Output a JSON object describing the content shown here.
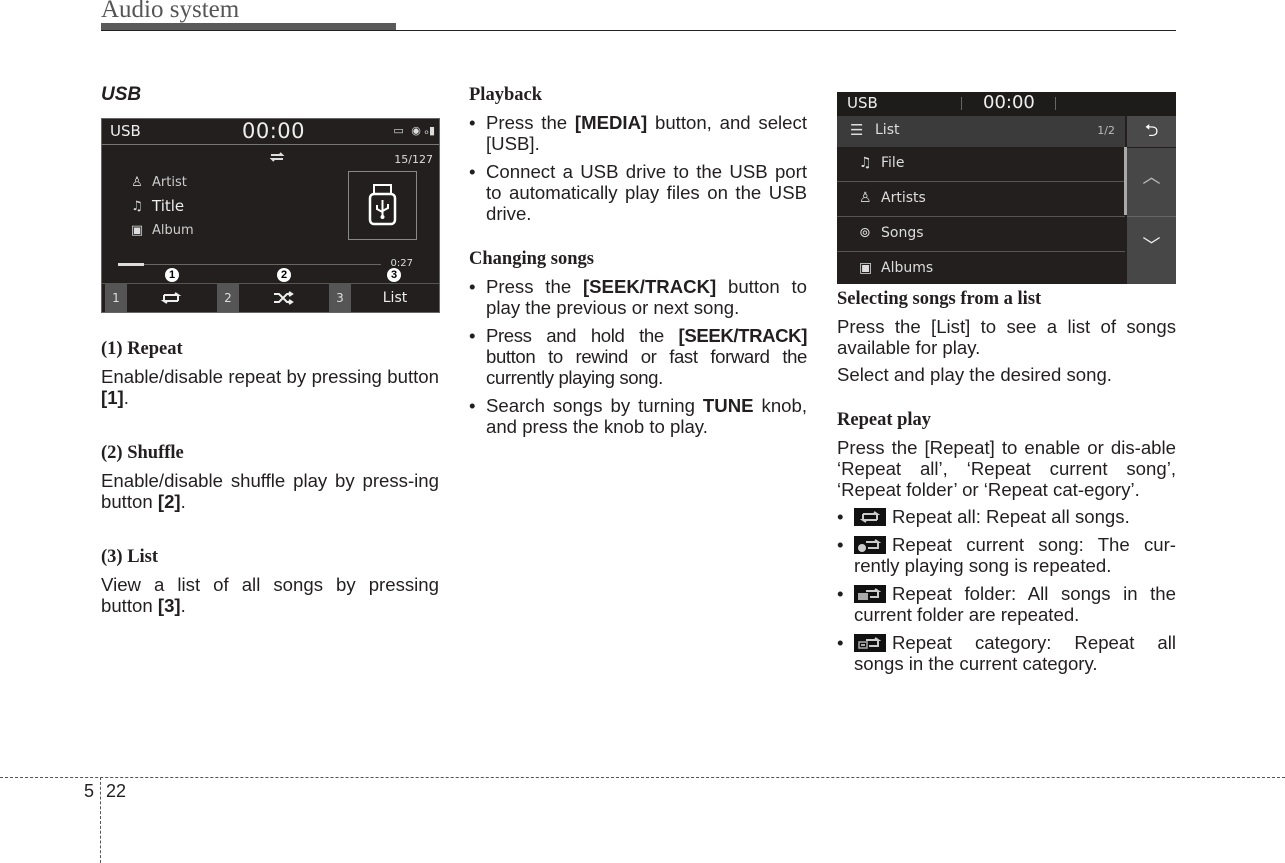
{
  "header": {
    "section_title": "Audio system"
  },
  "left_column": {
    "heading": "USB",
    "screen": {
      "source": "USB",
      "clock": "00:00",
      "status_icons": [
        "battery-icon",
        "bluetooth-audio-icon",
        "signal-strength-icon"
      ],
      "mode_icon": "repeat-icon",
      "track_count": "15/127",
      "artist_label": "Artist",
      "title_label": "Title",
      "album_label": "Album",
      "album_art_icon": "usb-drive-icon",
      "progress": 0.1,
      "duration": "0:27",
      "callouts": [
        "1",
        "2",
        "3"
      ],
      "buttons": [
        {
          "number": "1",
          "icon": "repeat-icon",
          "label": ""
        },
        {
          "number": "2",
          "icon": "shuffle-icon",
          "label": ""
        },
        {
          "number": "3",
          "icon": "",
          "label": "List"
        }
      ]
    },
    "sections": [
      {
        "heading": "(1) Repeat",
        "text_before": "Enable/disable repeat by pressing button ",
        "bold": "[1]",
        "text_after": "."
      },
      {
        "heading": "(2) Shuffle",
        "text_before": "Enable/disable shuffle play by press-ing button ",
        "bold": "[2]",
        "text_after": "."
      },
      {
        "heading": "(3) List",
        "text_before": "View a list of all songs by pressing button ",
        "bold": "[3]",
        "text_after": "."
      }
    ]
  },
  "middle_column": {
    "playback": {
      "heading": "Playback",
      "bullets": [
        {
          "before": "Press the ",
          "bold": "[MEDIA]",
          "after": " button, and select [USB]."
        },
        {
          "before": "Connect a USB drive to the USB port to automatically play files on the USB drive.",
          "bold": "",
          "after": ""
        }
      ]
    },
    "changing": {
      "heading": "Changing songs",
      "bullets": [
        {
          "before": "Press the ",
          "bold": "[SEEK/TRACK]",
          "after": " button to play the previous or next song."
        },
        {
          "before": "Press and hold the ",
          "bold": "[SEEK/TRACK]",
          "after": " button to rewind or fast forward the currently playing song."
        },
        {
          "before": "Search songs by turning ",
          "bold": "TUNE",
          "after": " knob, and press the knob to play."
        }
      ]
    }
  },
  "right_column": {
    "screen": {
      "source": "USB",
      "clock": "00:00",
      "list_title": "List",
      "page": "1/2",
      "back_icon": "back-icon",
      "up_icon": "chevron-up-icon",
      "down_icon": "chevron-down-icon",
      "items": [
        {
          "icon": "music-note-icon",
          "label": "File"
        },
        {
          "icon": "person-icon",
          "label": "Artists"
        },
        {
          "icon": "song-search-icon",
          "label": "Songs"
        },
        {
          "icon": "album-icon",
          "label": "Albums"
        }
      ]
    },
    "selecting": {
      "heading": "Selecting songs from a list",
      "para1": "Press the [List] to see a list of songs available for play.",
      "para2": "Select and play the desired song."
    },
    "repeat": {
      "heading": "Repeat play",
      "para": "Press the [Repeat] to enable or dis-able ‘Repeat all’, ‘Repeat current song’, ‘Repeat folder’ or ‘Repeat cat-egory’.",
      "modes": [
        {
          "icon": "repeat-all-icon",
          "text": "Repeat all: Repeat all songs."
        },
        {
          "icon": "repeat-one-icon",
          "text": "Repeat current song: The cur-rently playing song is repeated."
        },
        {
          "icon": "repeat-folder-icon",
          "text": "Repeat folder: All songs in the current folder are repeated."
        },
        {
          "icon": "repeat-category-icon",
          "text": "Repeat category: Repeat all songs in the current category."
        }
      ]
    }
  },
  "footer": {
    "section_number": "5",
    "page_number": "22"
  }
}
